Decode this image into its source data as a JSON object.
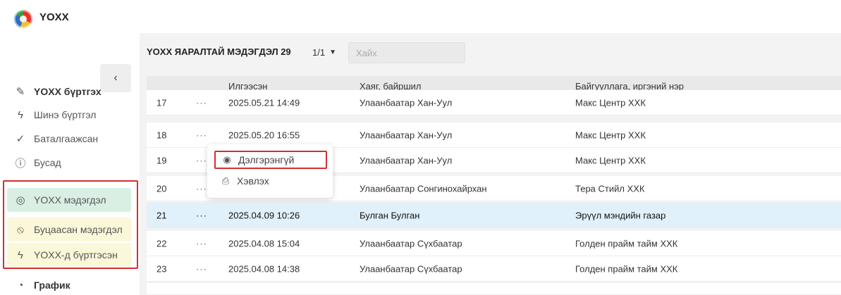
{
  "app": {
    "title": "YOXX"
  },
  "sidebar": {
    "collapse_glyph": "‹",
    "items": [
      {
        "label": "YOXX бүртгэх",
        "icon": "pen-icon",
        "glyph": "✎"
      },
      {
        "label": "Шинэ бүртгэл",
        "icon": "lightning-icon",
        "glyph": "ϟ"
      },
      {
        "label": "Баталгаажсан",
        "icon": "check-circle-icon",
        "glyph": "✓"
      },
      {
        "label": "Бусад",
        "icon": "info-circle-icon",
        "glyph": "ⓘ"
      },
      {
        "label": "YOXX мэдэгдэл",
        "icon": "location-pin-icon",
        "glyph": "◎"
      },
      {
        "label": "Буцаасан мэдэгдэл",
        "icon": "ban-icon",
        "glyph": "⃠"
      },
      {
        "label": "YOXX-д бүртгэсэн",
        "icon": "lightning-icon",
        "glyph": "ϟ"
      },
      {
        "label": "График",
        "icon": "clock-chart-icon",
        "glyph": "◔"
      }
    ]
  },
  "toolbar": {
    "title": "YOXX ЯАРАЛТАЙ МЭДЭГДЭЛ 29",
    "pager": "1/1",
    "search_placeholder": "Хайх"
  },
  "table": {
    "headers": [
      "Илгээсэн",
      "Хаяг, байршил",
      "Байгууллага, иргэний нэр"
    ],
    "rows": [
      {
        "num": "17",
        "dots": "···",
        "date": "2025.05.21 14:49",
        "addr": "Улаанбаатар Хан-Уул",
        "org": "Макс Центр ХХК"
      },
      {
        "num": "18",
        "dots": "···",
        "date": "2025.05.20 16:55",
        "addr": "Улаанбаатар Хан-Уул",
        "org": "Макс Центр ХХК"
      },
      {
        "num": "19",
        "dots": "···",
        "date": "",
        "addr": "Улаанбаатар Хан-Уул",
        "org": "Макс Центр ХХК"
      },
      {
        "num": "20",
        "dots": "···",
        "date": "",
        "addr": "Улаанбаатар Сонгинохайрхан",
        "org": "Тера Стийл ХХК"
      },
      {
        "num": "21",
        "dots": "···",
        "date": "2025.04.09 10:26",
        "addr": "Булган Булган",
        "org": "Эрүүл мэндийн газар"
      },
      {
        "num": "22",
        "dots": "···",
        "date": "2025.04.08 15:04",
        "addr": "Улаанбаатар Сүхбаатар",
        "org": "Голден прайм тайм ХХК"
      },
      {
        "num": "23",
        "dots": "···",
        "date": "2025.04.08 14:38",
        "addr": "Улаанбаатар Сүхбаатар",
        "org": "Голден прайм тайм ХХК"
      }
    ]
  },
  "context_menu": {
    "items": [
      {
        "label": "Дэлгэрэнгүй",
        "icon": "eye-icon",
        "glyph": "◉"
      },
      {
        "label": "Хэвлэх",
        "icon": "printer-icon",
        "glyph": "⎙"
      }
    ]
  },
  "colors": {
    "accent_highlight": "#d32f2f",
    "selected_row": "#e1f1fb",
    "active_nav": "#d9efe4"
  }
}
